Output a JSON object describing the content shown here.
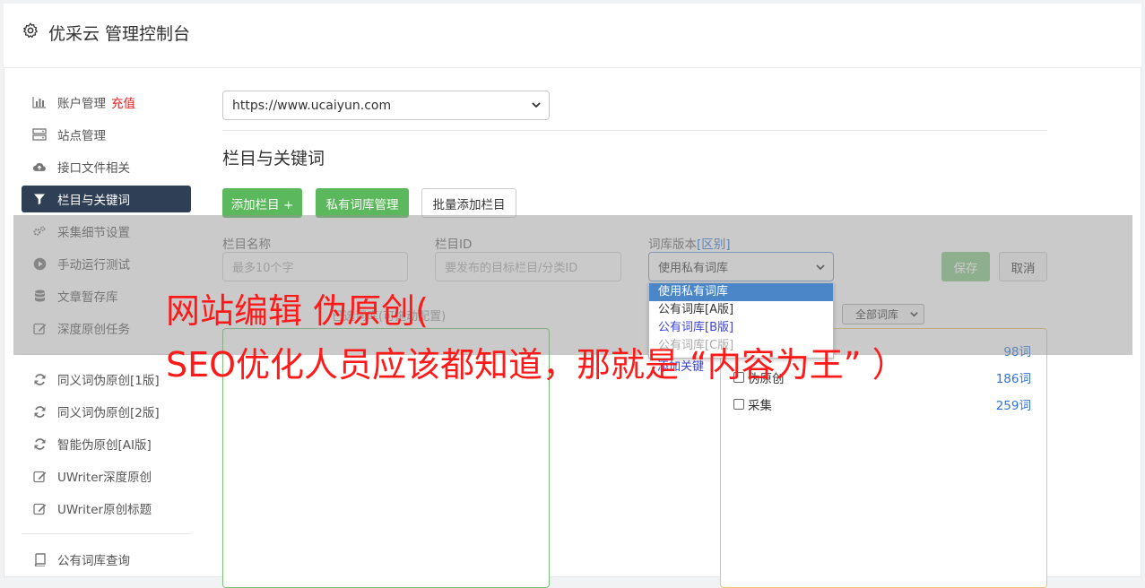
{
  "app": {
    "title": "优采云 管理控制台"
  },
  "sidebar": {
    "items": [
      {
        "label": "账户管理",
        "badge": "充值",
        "icon": "bar-chart-icon"
      },
      {
        "label": "站点管理",
        "icon": "server-icon"
      },
      {
        "label": "接口文件相关",
        "icon": "cloud-upload-icon"
      },
      {
        "label": "栏目与关键词",
        "icon": "filter-icon",
        "active": true
      },
      {
        "label": "采集细节设置",
        "icon": "gears-icon"
      },
      {
        "label": "手动运行测试",
        "icon": "play-icon"
      },
      {
        "label": "文章暂存库",
        "icon": "database-icon"
      },
      {
        "label": "深度原创任务",
        "icon": "edit-icon"
      },
      {
        "label": "同义词伪原创[1版]",
        "icon": "refresh-icon"
      },
      {
        "label": "同义词伪原创[2版]",
        "icon": "refresh-icon"
      },
      {
        "label": "智能伪原创[AI版]",
        "icon": "refresh-icon"
      },
      {
        "label": "UWriter深度原创",
        "icon": "edit-icon"
      },
      {
        "label": "UWriter原创标题",
        "icon": "edit-icon"
      },
      {
        "label": "公有词库查询",
        "icon": "book-icon"
      }
    ]
  },
  "main": {
    "site_select": "https://www.ucaiyun.com",
    "section_title": "栏目与关键词",
    "buttons": {
      "add_column": "添加栏目 +",
      "private_lib": "私有词库管理",
      "batch_add": "批量添加栏目"
    },
    "form": {
      "name_label": "栏目名称",
      "name_placeholder": "最多10个字",
      "id_label": "栏目ID",
      "id_placeholder": "要发布的目标栏目/分类ID",
      "version_label": "词库版本",
      "version_link": "[区别]",
      "version_value": "使用私有词库",
      "save": "保存",
      "cancel": "取消"
    },
    "dropdown_options": [
      "使用私有词库",
      "公有词库[A版]",
      "公有词库[B版]",
      "公有词库[C版]"
    ],
    "hint_left": "已选词库(可拖动配置)",
    "behind_text": "添加关键",
    "lib_filter": "全部词库",
    "libraries": [
      {
        "name": "",
        "count": "98词"
      },
      {
        "name": "伪原创",
        "count": "186词"
      },
      {
        "name": "采集",
        "count": "259词"
      }
    ]
  },
  "overlay": {
    "line1": "网站编辑 伪原创(",
    "line2": "SEO优化人员应该都知道，那就是 “内容为王” ）"
  },
  "colors": {
    "accent_green": "#5cb85c",
    "sidebar_active": "#2f4056",
    "overlay_red": "#ff1a1a",
    "link_blue": "#2f74d1"
  }
}
